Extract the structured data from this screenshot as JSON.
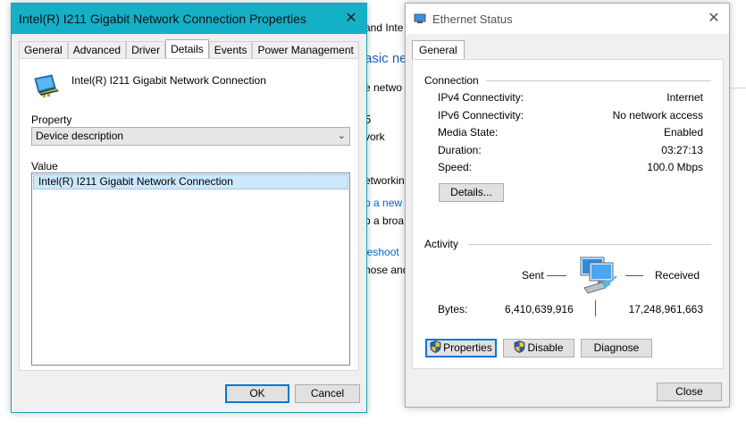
{
  "background": {
    "lines": [
      {
        "text": "and Inte",
        "color": "#000000"
      },
      {
        "text": "asic ne",
        "color": "#1a5fb4"
      },
      {
        "text": "e netwo",
        "color": "#000000"
      },
      {
        "text": "5",
        "color": "#000000"
      },
      {
        "text": "vork",
        "color": "#000000"
      },
      {
        "text": "etworkin",
        "color": "#000000"
      },
      {
        "text": "p a new",
        "color": "#0066cc"
      },
      {
        "text": "p a broa",
        "color": "#000000"
      },
      {
        "text": "leshoot",
        "color": "#0066cc"
      },
      {
        "text": "nose and",
        "color": "#000000"
      }
    ]
  },
  "properties_dialog": {
    "title": "Intel(R) I211 Gigabit Network Connection Properties",
    "close_glyph": "✕",
    "tabs": [
      {
        "label": "General",
        "active": false
      },
      {
        "label": "Advanced",
        "active": false
      },
      {
        "label": "Driver",
        "active": false
      },
      {
        "label": "Details",
        "active": true
      },
      {
        "label": "Events",
        "active": false
      },
      {
        "label": "Power Management",
        "active": false
      }
    ],
    "device_name": "Intel(R) I211 Gigabit Network Connection",
    "device_icon": "network-adapter-icon",
    "property_label": "Property",
    "property_value": "Device description",
    "value_label": "Value",
    "value_items": [
      "Intel(R) I211 Gigabit Network Connection"
    ],
    "ok_label": "OK",
    "cancel_label": "Cancel",
    "accent_color": "#14b0c8"
  },
  "ethernet_status": {
    "title": "Ethernet Status",
    "close_glyph": "✕",
    "tab_label": "General",
    "connection_header": "Connection",
    "rows": [
      {
        "label": "IPv4 Connectivity:",
        "value": "Internet"
      },
      {
        "label": "IPv6 Connectivity:",
        "value": "No network access"
      },
      {
        "label": "Media State:",
        "value": "Enabled"
      },
      {
        "label": "Duration:",
        "value": "03:27:13"
      },
      {
        "label": "Speed:",
        "value": "100.0 Mbps"
      }
    ],
    "details_label": "Details...",
    "activity_header": "Activity",
    "sent_label": "Sent",
    "received_label": "Received",
    "bytes_label": "Bytes:",
    "bytes_sent": "6,410,639,916",
    "bytes_received": "17,248,961,663",
    "properties_label": "Properties",
    "disable_label": "Disable",
    "diagnose_label": "Diagnose",
    "close_label": "Close"
  }
}
